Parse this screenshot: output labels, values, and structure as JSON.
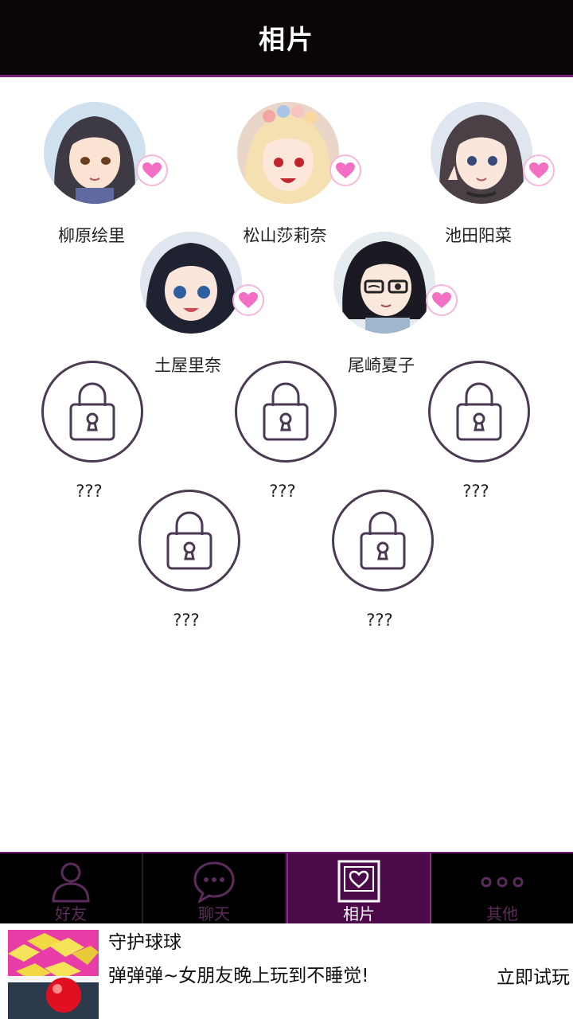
{
  "header": {
    "title": "相片"
  },
  "unlocked": [
    {
      "name": "柳原绘里",
      "hair": "#3e3a44",
      "skin": "#fbe3d4",
      "bg": "#cfe0ee",
      "eye": "#6a3e1a",
      "icon": "heart-icon"
    },
    {
      "name": "松山莎莉奈",
      "hair": "#f4e0b0",
      "skin": "#fde6da",
      "bg": "#e9d6c8",
      "eye": "#c0262b",
      "icon": "heart-icon"
    },
    {
      "name": "池田阳菜",
      "hair": "#4b4046",
      "skin": "#fbe6dc",
      "bg": "#dfe6ef",
      "eye": "#384a7a",
      "icon": "heart-icon"
    },
    {
      "name": "土屋里奈",
      "hair": "#1f2331",
      "skin": "#fbe6dc",
      "bg": "#dfe6ef",
      "eye": "#2b5fa0",
      "icon": "heart-icon"
    },
    {
      "name": "尾崎夏子",
      "hair": "#1b1a22",
      "skin": "#fbe8dd",
      "bg": "#e4ecef",
      "eye": "#2a2a2a",
      "icon": "heart-icon"
    }
  ],
  "locked": [
    {
      "name": "???"
    },
    {
      "name": "???"
    },
    {
      "name": "???"
    },
    {
      "name": "???"
    },
    {
      "name": "???"
    }
  ],
  "tabs": [
    {
      "label": "好友",
      "icon": "person-icon",
      "active": false
    },
    {
      "label": "聊天",
      "icon": "chat-bubble-icon",
      "active": false
    },
    {
      "label": "相片",
      "icon": "photo-heart-icon",
      "active": true
    },
    {
      "label": "其他",
      "icon": "more-dots-icon",
      "active": false
    }
  ],
  "ad": {
    "title": "守护球球",
    "description": "弹弹弹~女朋友晚上玩到不睡觉!",
    "cta": "立即试玩"
  },
  "colors": {
    "header_bg": "#0a0508",
    "accent_purple": "#7a1f7a",
    "active_tab_bg": "#4d0a4b",
    "heart_pink": "#f36fc4",
    "lock_ring": "#4a3a52"
  }
}
